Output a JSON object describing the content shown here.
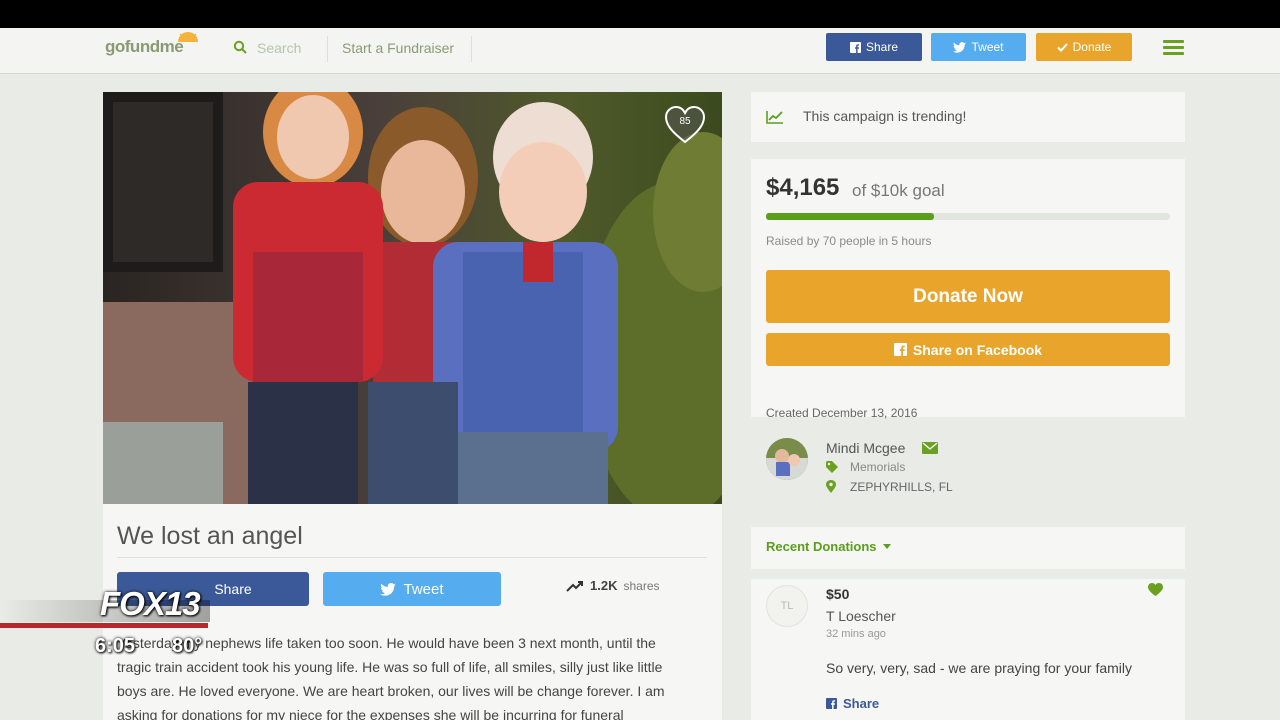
{
  "nav": {
    "logo": "gofundme",
    "search_placeholder": "Search",
    "start_label": "Start a Fundraiser",
    "share_label": "Share",
    "tweet_label": "Tweet",
    "donate_label": "Donate"
  },
  "campaign": {
    "title": "We lost an angel",
    "heart_count": "85",
    "share_label": "Share",
    "tweet_label": "Tweet",
    "shares_count": "1.2K",
    "shares_label": "shares",
    "story_lines": [
      "Yesterday my nephews life taken too soon. He would have been 3 next month, until the",
      "tragic train accident took his young life. He was so full of life, all smiles, silly just like little",
      "boys are. He loved everyone. We are heart broken, our lives will be change forever. I am",
      "asking for donations for my niece for the expenses she will be incurring for funeral"
    ]
  },
  "sidebar": {
    "trending_text": "This campaign is trending!",
    "raised_amount": "$4,165",
    "goal_text": "of $10k goal",
    "progress_fraction": 0.4165,
    "raised_by": "Raised by 70 people in 5 hours",
    "donate_now": "Donate Now",
    "share_facebook": "Share on Facebook",
    "created": "Created December 13, 2016",
    "organizer": "Mindi Mcgee",
    "category": "Memorials",
    "location": "ZEPHYRHILLS, FL",
    "recent_title": "Recent Donations",
    "donation": {
      "initials": "TL",
      "amount": "$50",
      "name": "T Loescher",
      "time": "32 mins ago",
      "message": "So very, very, sad - we are praying for your family",
      "share_label": "Share"
    }
  },
  "overlay": {
    "station": "FOX13",
    "time": "6:05",
    "temp": "80°"
  },
  "colors": {
    "brand_green": "#5a9e1c",
    "donate_orange": "#e9a42b",
    "facebook_blue": "#3b5998",
    "twitter_blue": "#55acee",
    "fox_red": "#b8272b"
  }
}
